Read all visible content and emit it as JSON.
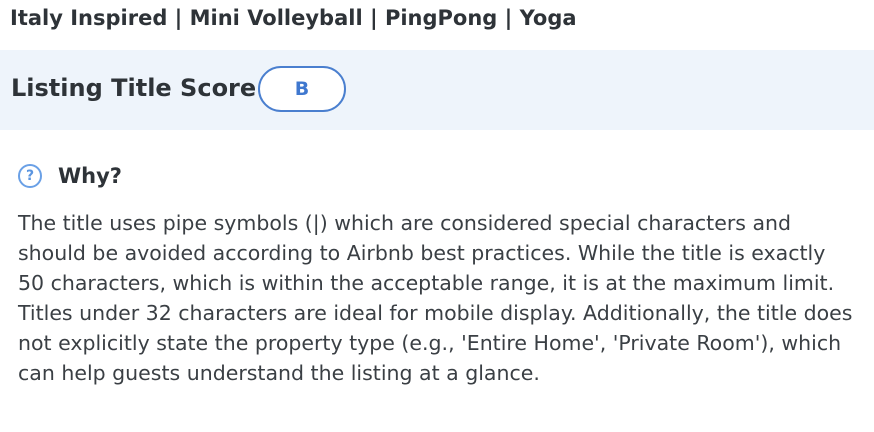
{
  "listing": {
    "title": "Italy Inspired | Mini Volleyball | PingPong | Yoga"
  },
  "score": {
    "label": "Listing Title Score",
    "grade": "B",
    "accent_color": "#4a7fcf",
    "band_color": "#eef4fb"
  },
  "why": {
    "icon": "question-circle-icon",
    "icon_glyph": "?",
    "label": "Why?",
    "text": "The title uses pipe symbols (|) which are considered special characters and should be avoided according to Airbnb best practices. While the title is exactly 50 characters, which is within the acceptable range, it is at the maximum limit. Titles under 32 characters are ideal for mobile display. Additionally, the title does not explicitly state the property type (e.g., 'Entire Home', 'Private Room'), which can help guests understand the listing at a glance."
  }
}
